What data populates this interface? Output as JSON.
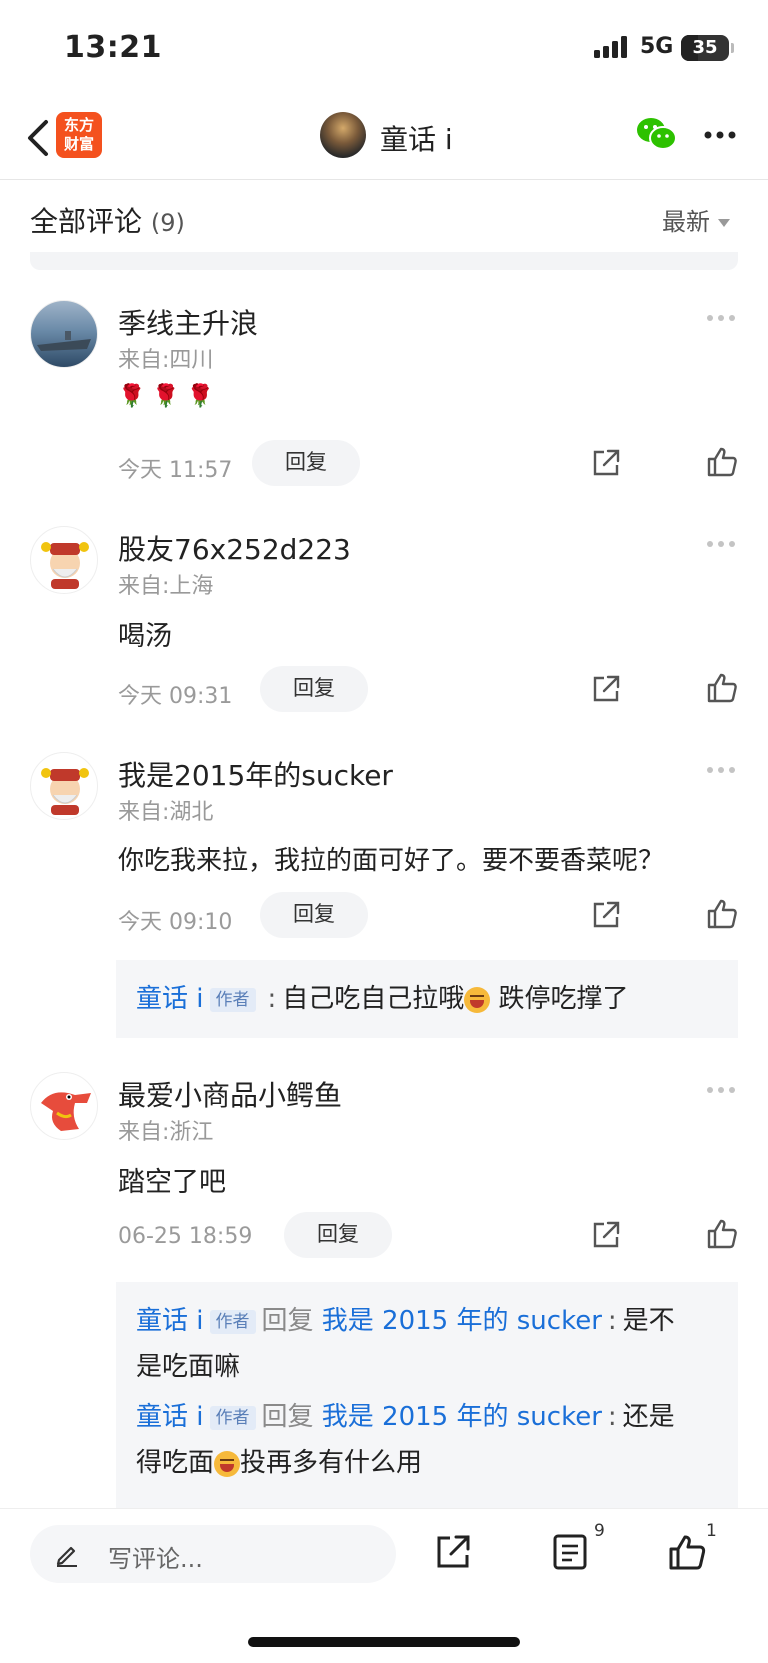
{
  "status_bar": {
    "time": "13:21",
    "network": "5G",
    "battery": "35",
    "battery_level": 0.35
  },
  "nav": {
    "logo_text_1": "东方",
    "logo_text_2": "财富",
    "title": "童话 i"
  },
  "comments_header": {
    "label": "全部评论",
    "count": "(9)",
    "sort": "最新"
  },
  "comments": [
    {
      "name": "季线主升浪",
      "from": "来自:四川",
      "body": "🌹 🌹 🌹",
      "time": "今天 11:57",
      "reply_label": "回复"
    },
    {
      "name": "股友76x252d223",
      "from": "来自:上海",
      "body": "喝汤",
      "time": "今天 09:31",
      "reply_label": "回复"
    },
    {
      "name": "我是2015年的sucker",
      "from": "来自:湖北",
      "body": "你吃我来拉，我拉的面可好了。要不要香菜呢？",
      "time": "今天 09:10",
      "reply_label": "回复",
      "sub_replies": [
        {
          "author": "童话 i",
          "tag": "作者",
          "colon": ":",
          "text_a": "自己吃自己拉哦",
          "text_b": "跌停吃撑了"
        }
      ]
    },
    {
      "name": "最爱小商品小鳄鱼",
      "from": "来自:浙江",
      "body": "踏空了吧",
      "time": "06-25 18:59",
      "reply_label": "回复",
      "sub_replies": [
        {
          "author": "童话 i",
          "tag": "作者",
          "reply_word": "回复",
          "target": "我是 2015 年的 sucker",
          "colon": ":",
          "text_a": "是不",
          "text_b": "是吃面嘛"
        },
        {
          "author": "童话 i",
          "tag": "作者",
          "reply_word": "回复",
          "target": "我是 2015 年的 sucker",
          "colon": ":",
          "text_a": "还是",
          "text_b": "得吃面",
          "text_c": "投再多有什么用"
        }
      ]
    }
  ],
  "bottom_bar": {
    "placeholder": "写评论...",
    "comment_count": "9",
    "like_count": "1"
  },
  "icons": {
    "back": "chevron-left-icon",
    "wechat": "wechat-icon",
    "more": "more-dots-icon",
    "share": "share-icon",
    "like": "thumbs-up-icon",
    "list": "comment-list-icon",
    "edit": "pencil-icon",
    "emoji": "grin-emoji-icon"
  },
  "colors": {
    "brand": "#f4511e",
    "author_link": "#1a6fd8",
    "wechat": "#2dc100"
  }
}
